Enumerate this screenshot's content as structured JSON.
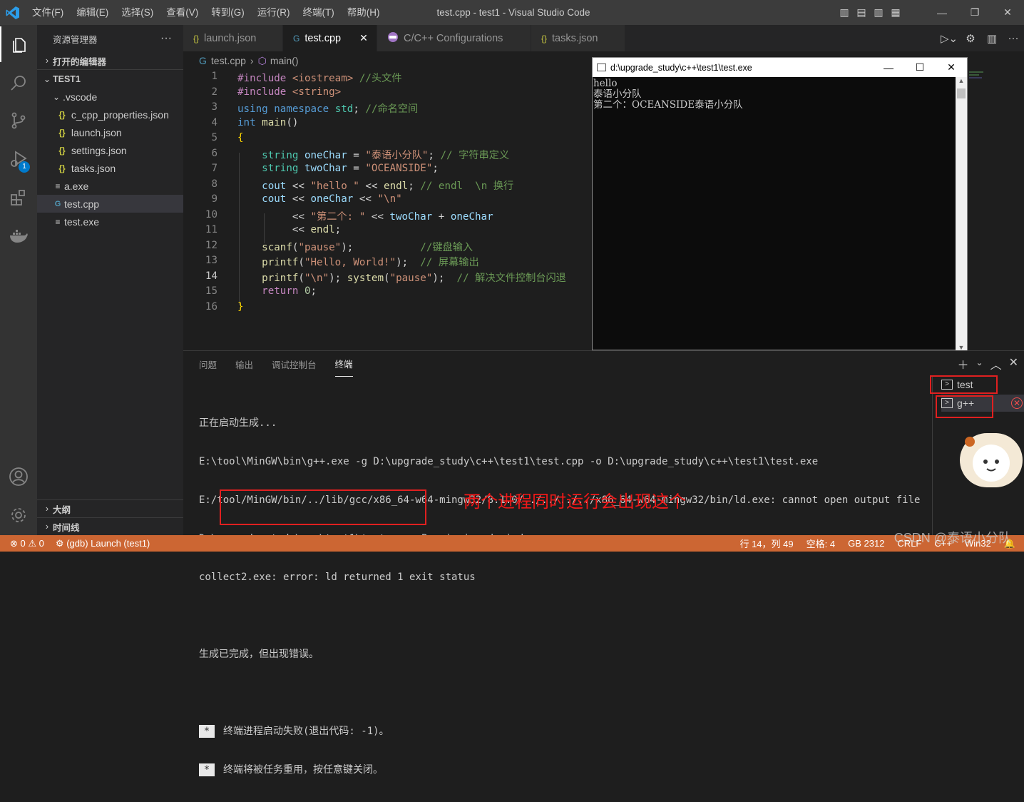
{
  "menu": [
    "文件(F)",
    "编辑(E)",
    "选择(S)",
    "查看(V)",
    "转到(G)",
    "运行(R)",
    "终端(T)",
    "帮助(H)"
  ],
  "window_title": "test.cpp - test1 - Visual Studio Code",
  "activity": {
    "debug_badge": "1"
  },
  "sidebar": {
    "title": "资源管理器",
    "more": "···",
    "open_editors": "打开的编辑器",
    "workspace": "TEST1",
    "items": [
      {
        "label": ".vscode",
        "icon": "chevron-down",
        "indent": 1
      },
      {
        "label": "c_cpp_properties.json",
        "icon": "{}",
        "indent": 2
      },
      {
        "label": "launch.json",
        "icon": "{}",
        "indent": 2
      },
      {
        "label": "settings.json",
        "icon": "{}",
        "indent": 2
      },
      {
        "label": "tasks.json",
        "icon": "{}",
        "indent": 2
      },
      {
        "label": "a.exe",
        "icon": "≡",
        "indent": 1
      },
      {
        "label": "test.cpp",
        "icon": "C++",
        "indent": 1,
        "selected": true
      },
      {
        "label": "test.exe",
        "icon": "≡",
        "indent": 1
      }
    ],
    "outline": "大纲",
    "timeline": "时间线"
  },
  "tabs": [
    {
      "label": "launch.json",
      "icon": "{}"
    },
    {
      "label": "test.cpp",
      "icon": "C++",
      "active": true,
      "close": "✕"
    },
    {
      "label": "C/C++ Configurations",
      "icon": "cfg"
    },
    {
      "label": "tasks.json",
      "icon": "{}"
    }
  ],
  "breadcrumb": {
    "file": "test.cpp",
    "symbol": "main()"
  },
  "code_lines": [
    "1",
    "2",
    "3",
    "4",
    "5",
    "6",
    "7",
    "8",
    "9",
    "10",
    "11",
    "12",
    "13",
    "14",
    "15",
    "16"
  ],
  "current_line": 14,
  "console": {
    "title": "d:\\upgrade_study\\c++\\test1\\test.exe",
    "lines": [
      "hello",
      "泰语小分队",
      "第二个：OCEANSIDE泰语小分队"
    ]
  },
  "panel": {
    "tabs": [
      "问题",
      "输出",
      "调试控制台",
      "终端"
    ],
    "active_tab": "终端",
    "terminal_lines": [
      "正在启动生成...",
      "E:\\tool\\MinGW\\bin\\g++.exe -g D:\\upgrade_study\\c++\\test1\\test.cpp -o D:\\upgrade_study\\c++\\test1\\test.exe",
      "E:/tool/MinGW/bin/../lib/gcc/x86_64-w64-mingw32/8.1.0/../../../../x86_64-w64-mingw32/bin/ld.exe: cannot open output file",
      "D:\\upgrade_study\\c++\\test1\\test.exe: Permission denied",
      "collect2.exe: error: ld returned 1 exit status",
      "",
      "生成已完成，但出现错误。",
      "",
      "终端进程启动失败(退出代码: -1)。",
      "终端将被任务重用，按任意键关闭。"
    ],
    "terminals": [
      "test",
      "g++"
    ]
  },
  "annotation": "两个进程同时运行会出现这个",
  "status": {
    "errors": "0",
    "warnings": "0",
    "debug": "(gdb) Launch (test1)",
    "position": "行 14，列 49",
    "spaces": "空格: 4",
    "encoding": "GB 2312",
    "eol": "CRLF",
    "lang": "C++",
    "platform": "Win32"
  },
  "watermark": "CSDN @泰语小分队"
}
